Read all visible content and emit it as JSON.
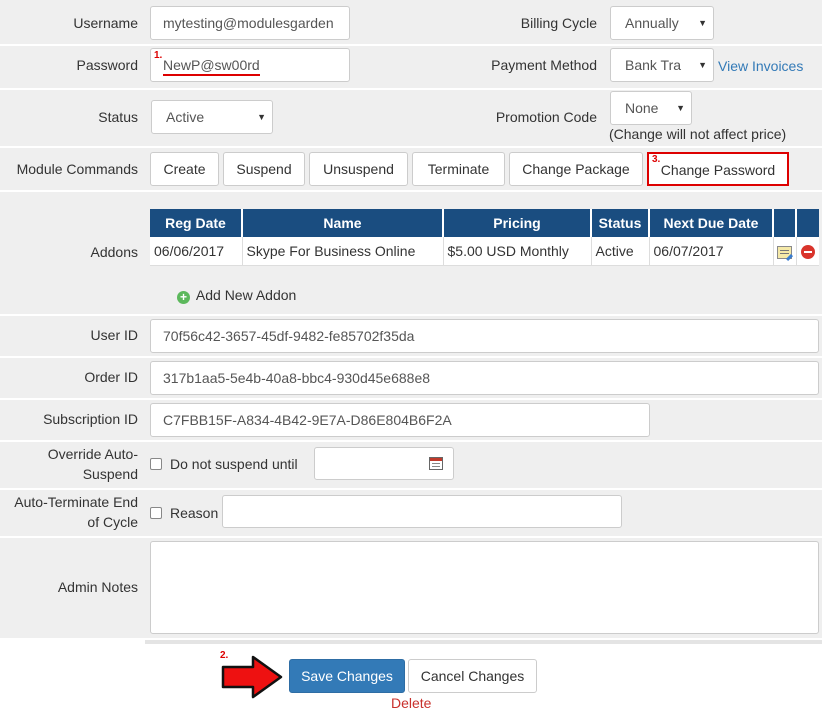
{
  "form": {
    "username": {
      "label": "Username",
      "value": "mytesting@modulesgarden"
    },
    "password": {
      "label": "Password",
      "value": "NewP@sw00rd",
      "step": "1."
    },
    "status": {
      "label": "Status",
      "value": "Active"
    },
    "billing_cycle": {
      "label": "Billing Cycle",
      "value": "Annually"
    },
    "payment_method": {
      "label": "Payment Method",
      "value": "Bank Tra",
      "link": "View Invoices"
    },
    "promotion_code": {
      "label": "Promotion Code",
      "value": "None",
      "note": "(Change will not affect price)"
    },
    "module_commands": {
      "label": "Module Commands",
      "buttons": [
        "Create",
        "Suspend",
        "Unsuspend",
        "Terminate",
        "Change Package",
        "Change Password"
      ],
      "step": "3."
    },
    "addons": {
      "label": "Addons",
      "columns": [
        "Reg Date",
        "Name",
        "Pricing",
        "Status",
        "Next Due Date",
        "",
        ""
      ],
      "rows": [
        {
          "reg_date": "06/06/2017",
          "name": "Skype For Business Online",
          "pricing": "$5.00 USD Monthly",
          "status": "Active",
          "next_due": "06/07/2017"
        }
      ],
      "add_link": "Add New Addon"
    },
    "user_id": {
      "label": "User ID",
      "value": "70f56c42-3657-45df-9482-fe85702f35da"
    },
    "order_id": {
      "label": "Order ID",
      "value": "317b1aa5-5e4b-40a8-bbc4-930d45e688e8"
    },
    "subscription_id": {
      "label": "Subscription ID",
      "value": "C7FBB15F-A834-4B42-9E7A-D86E804B6F2A"
    },
    "override_suspend": {
      "label_line1": "Override Auto-",
      "label_line2": "Suspend",
      "checkbox_label": "Do not suspend until"
    },
    "auto_terminate": {
      "label_line1": "Auto-Terminate End",
      "label_line2": "of Cycle",
      "checkbox_label": "Reason"
    },
    "admin_notes": {
      "label": "Admin Notes",
      "value": ""
    }
  },
  "actions": {
    "step": "2.",
    "save": "Save Changes",
    "cancel": "Cancel Changes",
    "delete": "Delete"
  },
  "colors": {
    "band": "#efefef",
    "table_header": "#1a4d80",
    "primary": "#337ab7",
    "annotation": "#dd0000"
  }
}
